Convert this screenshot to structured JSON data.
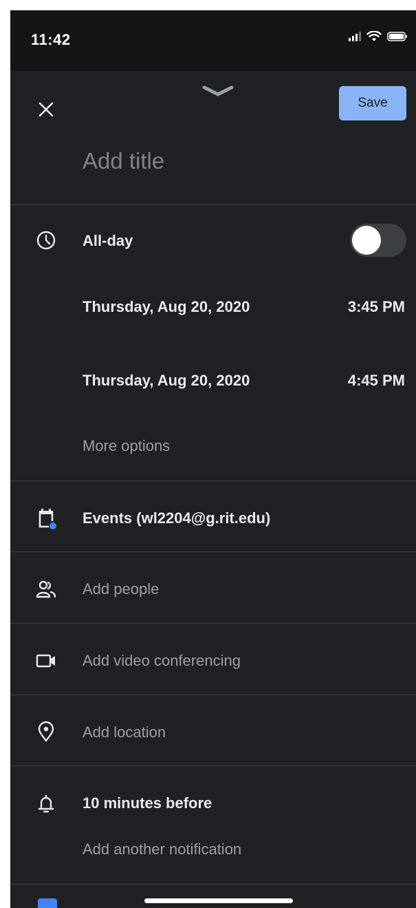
{
  "status_bar": {
    "time": "11:42"
  },
  "header": {
    "save_label": "Save",
    "title_placeholder": "Add title"
  },
  "schedule": {
    "all_day_label": "All-day",
    "all_day_on": false,
    "start_date": "Thursday, Aug 20, 2020",
    "start_time": "3:45 PM",
    "end_date": "Thursday, Aug 20, 2020",
    "end_time": "4:45 PM",
    "more_options": "More options"
  },
  "calendar": {
    "label": "Events (wl2204@g.rit.edu)",
    "accent": "#4285f4"
  },
  "people": {
    "label": "Add people"
  },
  "video": {
    "label": "Add video conferencing"
  },
  "location": {
    "label": "Add location"
  },
  "notifications": {
    "label": "10 minutes before",
    "add_label": "Add another notification"
  },
  "colors": {
    "background": "#202124",
    "save_button": "#8ab4f8",
    "divider": "#3c4043"
  }
}
